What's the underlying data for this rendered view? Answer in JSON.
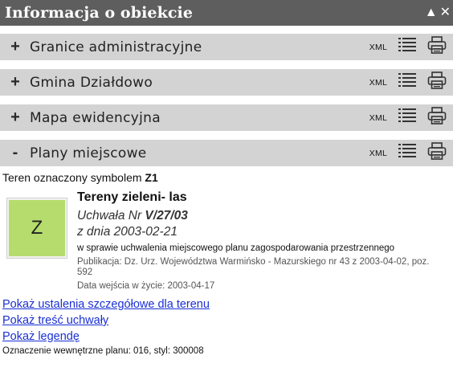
{
  "window": {
    "title": "Informacja o obiekcie",
    "collapse_glyph": "▲",
    "close_glyph": "✕"
  },
  "sections": [
    {
      "toggle": "+",
      "label": "Granice administracyjne",
      "xml": "XML",
      "expanded": false
    },
    {
      "toggle": "+",
      "label": "Gmina Działdowo",
      "xml": "XML",
      "expanded": false
    },
    {
      "toggle": "+",
      "label": "Mapa ewidencyjna",
      "xml": "XML",
      "expanded": false
    },
    {
      "toggle": "-",
      "label": "Plany miejscowe",
      "xml": "XML",
      "expanded": true
    }
  ],
  "plan": {
    "teren_prefix": "Teren oznaczony symbolem",
    "symbol": "Z1",
    "zone_letter": "Z",
    "zone_color": "#b5dc6d",
    "zone_name": "Tereny zieleni- las",
    "uchwala_prefix": "Uchwała Nr",
    "uchwala_number": "V/27/03",
    "date_line": "z dnia 2003-02-21",
    "w_sprawie": "w sprawie uchwalenia miejscowego planu zagospodarowania przestrzennego",
    "publikacja": "Publikacja: Dz. Urz. Województwa Warmińsko - Mazurskiego nr 43 z 2003-04-02, poz. 592",
    "data_wejscia": "Data wejścia w życie: 2003-04-17",
    "links": {
      "ustalenia": "Pokaż ustalenia szczegółowe dla terenu",
      "tresc": "Pokaż treść uchwały",
      "legenda": "Pokaż legendę"
    },
    "oznaczenie": "Oznaczenie wewnętrzne planu: 016, styl: 300008"
  },
  "colors": {
    "titlebar": "#5e5e5e",
    "section_bg": "#d3d3d3",
    "link": "#1a2fd4"
  },
  "icons": [
    "list-icon",
    "printer-icon",
    "collapse-icon",
    "close-icon"
  ]
}
